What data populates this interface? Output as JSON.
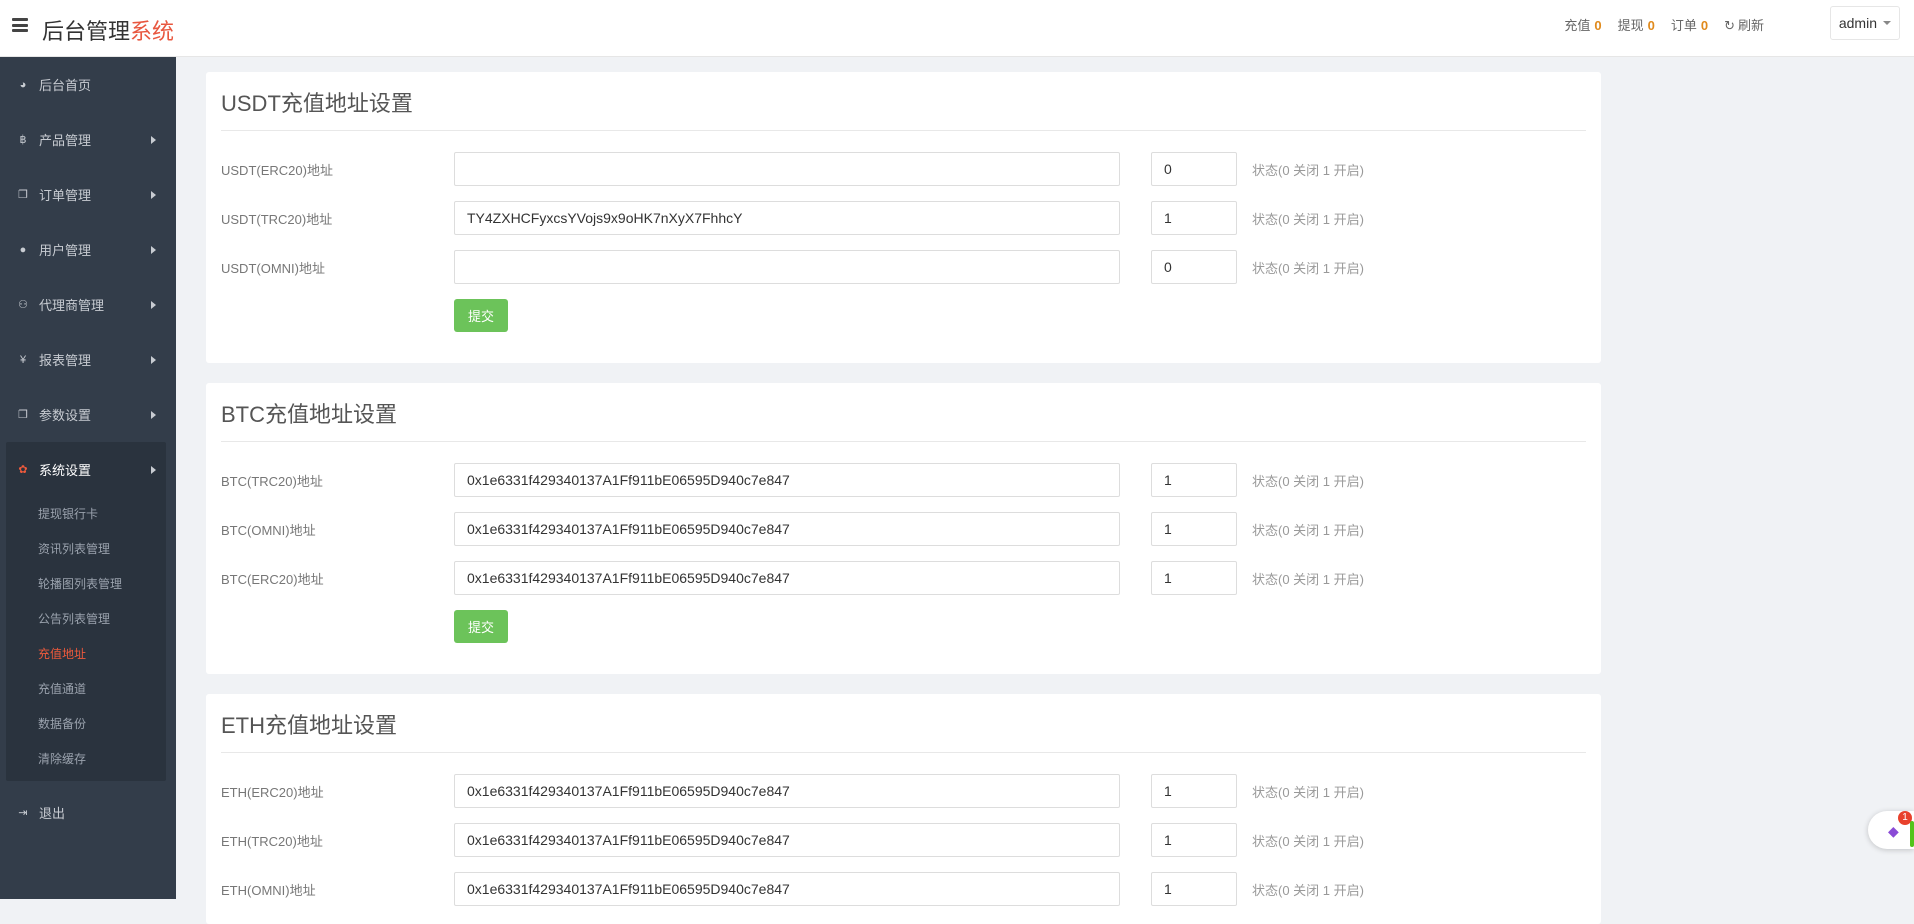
{
  "header": {
    "brand_main": "后台管理",
    "brand_accent": "系统",
    "stats": [
      {
        "label": "充值",
        "value": "0"
      },
      {
        "label": "提现",
        "value": "0"
      },
      {
        "label": "订单",
        "value": "0"
      }
    ],
    "refresh_label": "刷新",
    "user": "admin"
  },
  "sidebar": {
    "items": [
      {
        "label": "后台首页",
        "icon": "dashboard-icon"
      },
      {
        "label": "产品管理",
        "icon": "bitcoin-icon"
      },
      {
        "label": "订单管理",
        "icon": "copy-icon"
      },
      {
        "label": "用户管理",
        "icon": "user-icon"
      },
      {
        "label": "代理商管理",
        "icon": "sitemap-icon"
      },
      {
        "label": "报表管理",
        "icon": "yen-icon"
      },
      {
        "label": "参数设置",
        "icon": "copy-icon"
      }
    ],
    "active_group": {
      "label": "系统设置",
      "icon": "gears-icon",
      "children": [
        "提现银行卡",
        "资讯列表管理",
        "轮播图列表管理",
        "公告列表管理",
        "充值地址",
        "充值通道",
        "数据备份",
        "清除缓存"
      ]
    },
    "logout": "退出"
  },
  "sections": [
    {
      "title": "USDT充值地址设置",
      "rows": [
        {
          "label": "USDT(ERC20)地址",
          "address": "",
          "status": "0"
        },
        {
          "label": "USDT(TRC20)地址",
          "address": "TY4ZXHCFyxcsYVojs9x9oHK7nXyX7FhhcY",
          "status": "1"
        },
        {
          "label": "USDT(OMNI)地址",
          "address": "",
          "status": "0"
        }
      ],
      "submit": "提交"
    },
    {
      "title": "BTC充值地址设置",
      "rows": [
        {
          "label": "BTC(TRC20)地址",
          "address": "0x1e6331f429340137A1Ff911bE06595D940c7e847",
          "status": "1"
        },
        {
          "label": "BTC(OMNI)地址",
          "address": "0x1e6331f429340137A1Ff911bE06595D940c7e847",
          "status": "1"
        },
        {
          "label": "BTC(ERC20)地址",
          "address": "0x1e6331f429340137A1Ff911bE06595D940c7e847",
          "status": "1"
        }
      ],
      "submit": "提交"
    },
    {
      "title": "ETH充值地址设置",
      "rows": [
        {
          "label": "ETH(ERC20)地址",
          "address": "0x1e6331f429340137A1Ff911bE06595D940c7e847",
          "status": "1"
        },
        {
          "label": "ETH(TRC20)地址",
          "address": "0x1e6331f429340137A1Ff911bE06595D940c7e847",
          "status": "1"
        },
        {
          "label": "ETH(OMNI)地址",
          "address": "0x1e6331f429340137A1Ff911bE06595D940c7e847",
          "status": "1"
        }
      ]
    }
  ],
  "status_hint": "状态(0 关闭 1 开启)",
  "widget_badge": "1"
}
